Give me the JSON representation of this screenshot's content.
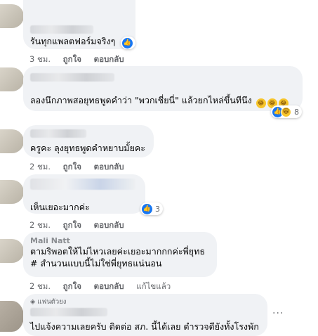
{
  "comments": [
    {
      "text": "รันทุกแพลตฟอร์มจริงๆ",
      "time": "3 ชม."
    },
    {
      "text": "ลองนึกภาพสอยุทธพูดคำว่า \"พวกเชี่ยนี่\" แล้วยกไหล่ขึ้นทีนึง",
      "reaction_count": "8"
    },
    {
      "text": "ครูคะ ลุงยุทธพูดคำหยาบมั้ยคะ",
      "time": "2 ชม."
    },
    {
      "text": "เห็นเยอะมากค่ะ",
      "time": "2 ชม.",
      "reaction_count": "3"
    },
    {
      "name": "Mali Natt",
      "line1": "ตามริพอตให้ไม่ไหวเลยค่ะเยอะมากกกค่ะพี่ยุทธ",
      "line2": "# สำนวนแบบนี้ไม่ใช่พี่ยุทธแน่นอน",
      "time": "2 ชม.",
      "edited": "แก้ไขแล้ว"
    },
    {
      "badge": "แฟนตัวยง",
      "text": "ไปแจ้งความเลยครับ ติดต่อ สภ. นี้ได้เลย ตำรวจดียังทั้งโรงพัก"
    }
  ],
  "actions": {
    "like": "ถูกใจ",
    "reply": "ตอบกลับ"
  },
  "icons": {
    "like": "like-icon",
    "haha": "haha-icon",
    "more": "more-options-icon",
    "badge": "diamond-icon"
  },
  "colors": {
    "bubble": "#f0f2f5",
    "like_blue": "#1877f2",
    "meta_gray": "#65676b"
  }
}
